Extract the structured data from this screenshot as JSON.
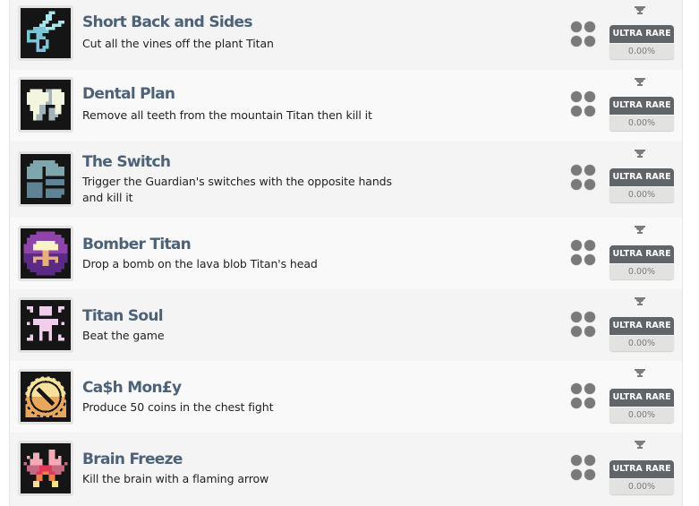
{
  "achievements": [
    {
      "title": "Short Back and Sides",
      "description": "Cut all the vines off the plant Titan",
      "icon": "scissors-icon",
      "rarity": "ULTRA RARE",
      "percent": "0.00%"
    },
    {
      "title": "Dental Plan",
      "description": "Remove all teeth from the mountain Titan then kill it",
      "icon": "tooth-icon",
      "rarity": "ULTRA RARE",
      "percent": "0.00%"
    },
    {
      "title": "The Switch",
      "description": "Trigger the Guardian's switches with the opposite hands and kill it",
      "icon": "guardian-switch-icon",
      "rarity": "ULTRA RARE",
      "percent": "0.00%"
    },
    {
      "title": "Bomber Titan",
      "description": "Drop a bomb on the lava blob Titan's head",
      "icon": "mushroom-cloud-icon",
      "rarity": "ULTRA RARE",
      "percent": "0.00%"
    },
    {
      "title": "Titan Soul",
      "description": "Beat the game",
      "icon": "titan-soul-figure-icon",
      "rarity": "ULTRA RARE",
      "percent": "0.00%"
    },
    {
      "title": "Ca$h Mon£y",
      "description": "Produce 50 coins in the chest fight",
      "icon": "coin-icon",
      "rarity": "ULTRA RARE",
      "percent": "0.00%"
    },
    {
      "title": "Brain Freeze",
      "description": "Kill the brain with a flaming arrow",
      "icon": "flaming-brain-icon",
      "rarity": "ULTRA RARE",
      "percent": "0.00%"
    }
  ],
  "colors": {
    "title": "#4d6277",
    "rarity_badge": "#5f6569",
    "percent_bg": "#e2e3e0"
  }
}
